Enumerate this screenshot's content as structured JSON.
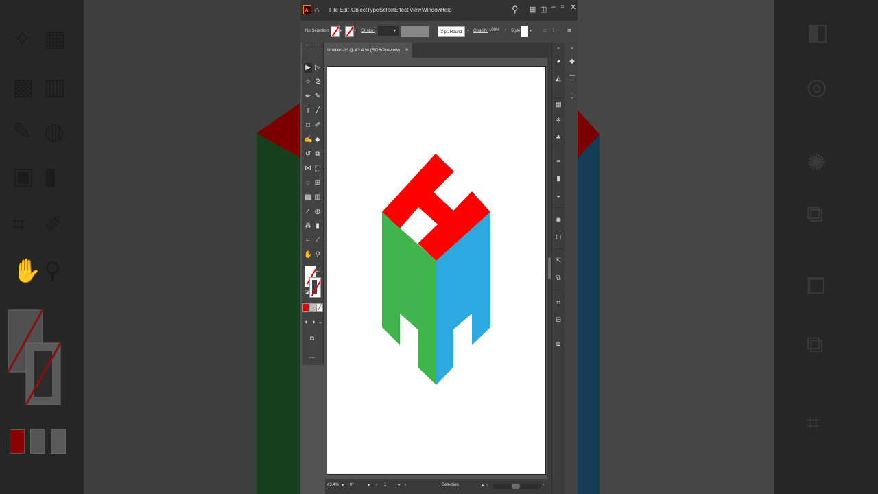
{
  "menubar": {
    "logo": "Ai",
    "items": [
      "File",
      "Edit",
      "Object",
      "Type",
      "Select",
      "Effect",
      "View",
      "Window",
      "Help"
    ]
  },
  "controlbar": {
    "selection_label": "No Selection",
    "stroke_label": "Stroke:",
    "brush_label": "3 pt. Round",
    "opacity_label": "Opacity:",
    "opacity_value": "100%",
    "style_label": "Style:"
  },
  "document_tab": {
    "title": "Untitled-1* @ 43.4 % (RGB/Preview)",
    "close": "×"
  },
  "statusbar": {
    "zoom": "43.4%",
    "rotation": "0°",
    "artboard_number": "1",
    "tool_name": "Selection"
  },
  "artwork": {
    "top_color": "#fe0000",
    "left_color": "#3eb64b",
    "right_color": "#2ea9e0"
  },
  "colors": {
    "fill_none_slash": "#e00000",
    "accent_orange": "#ff7c00"
  }
}
